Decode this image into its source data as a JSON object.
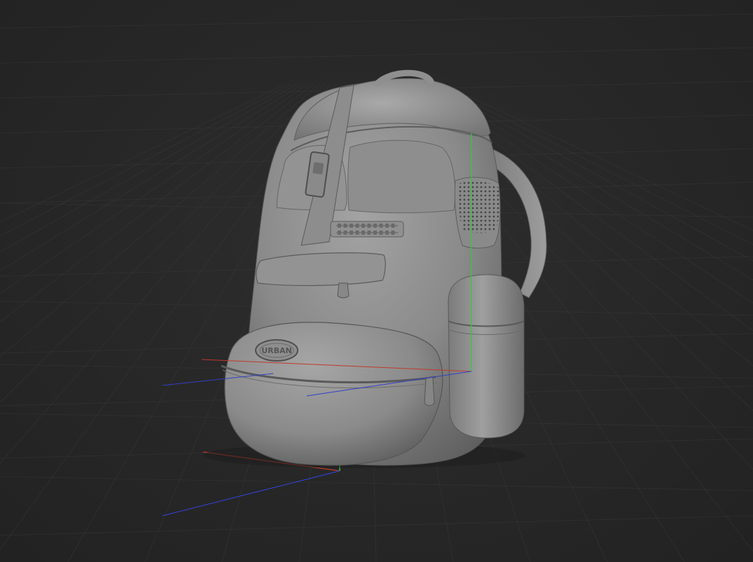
{
  "viewport": {
    "background_color": "#262626",
    "grid_color": "#3a3a3a",
    "model_color": "#8c8c8c"
  },
  "axes": {
    "x_color": "#c0392b",
    "y_color": "#2ecc40",
    "z_color": "#3040c8"
  },
  "model": {
    "name": "backpack",
    "badge_text": "URBAN"
  }
}
